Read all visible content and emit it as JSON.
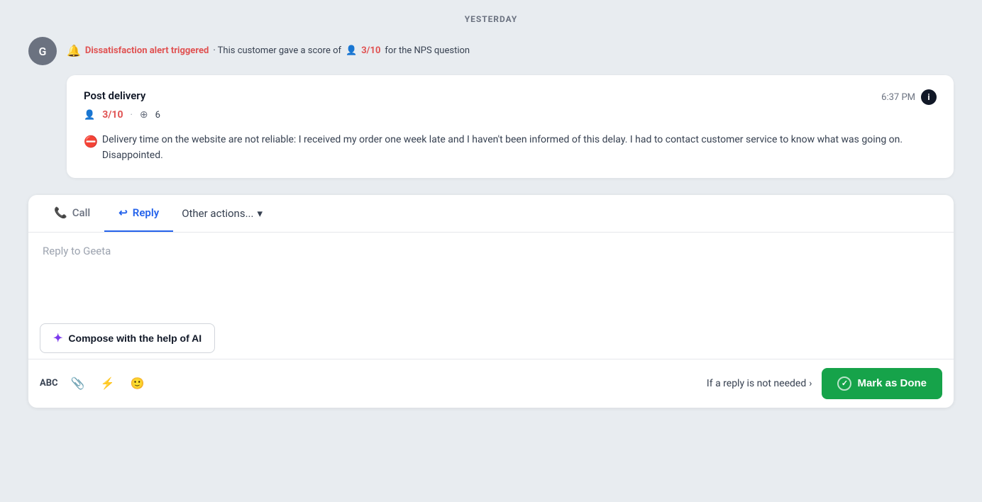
{
  "date_label": "YESTERDAY",
  "alert": {
    "avatar_initial": "G",
    "alert_title": "Dissatisfaction alert triggered",
    "alert_description": "· This customer gave a score of",
    "nps_score": "3/10",
    "nps_suffix": "for the NPS question"
  },
  "survey_card": {
    "title": "Post delivery",
    "time": "6:37 PM",
    "score": "3",
    "score_suffix": "/10",
    "layers_count": "6",
    "body_text": "Delivery time on the website are not reliable: I received my order one week late and I haven't been informed of this delay. I had to contact customer service to know what was going on. Disappointed."
  },
  "tabs": {
    "call_label": "Call",
    "reply_label": "Reply",
    "other_label": "Other actions..."
  },
  "reply": {
    "placeholder": "Reply to Geeta",
    "compose_ai_label": "Compose with the help of AI"
  },
  "footer": {
    "abc_label": "ABC",
    "not_needed_label": "If a reply is not needed",
    "mark_done_label": "Mark as Done"
  }
}
